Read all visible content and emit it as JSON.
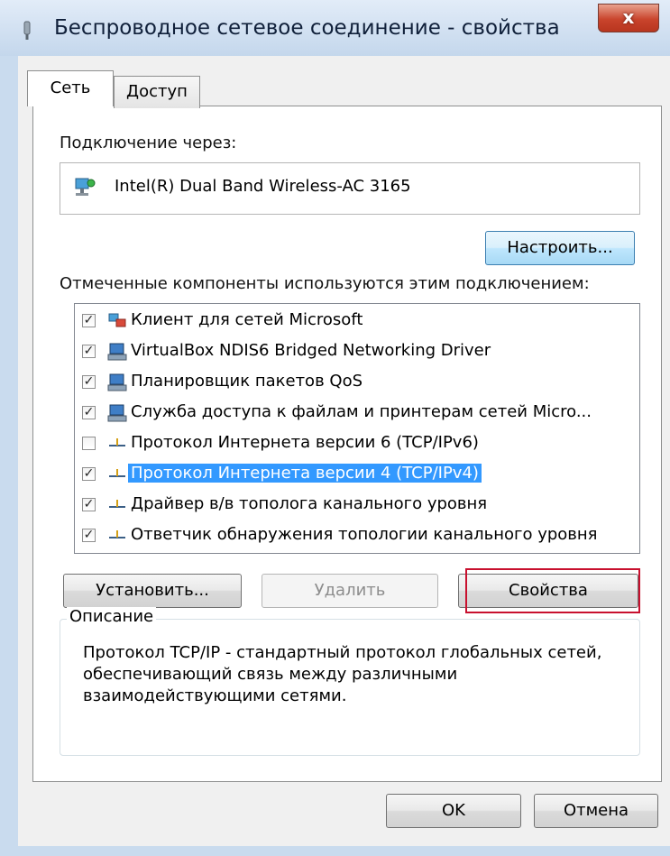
{
  "window": {
    "title": "Беспроводное сетевое соединение - свойства",
    "close_label": "x"
  },
  "tabs": [
    {
      "label": "Сеть",
      "active": true
    },
    {
      "label": "Доступ",
      "active": false
    }
  ],
  "connection": {
    "label": "Подключение через:",
    "adapter_name": "Intel(R) Dual Band Wireless-AC 3165",
    "configure_button": "Настроить..."
  },
  "components": {
    "label": "Отмеченные компоненты используются этим подключением:",
    "items": [
      {
        "label": "Клиент для сетей Microsoft",
        "checked": true,
        "icon": "network-client-icon",
        "selected": false
      },
      {
        "label": "VirtualBox NDIS6 Bridged Networking Driver",
        "checked": true,
        "icon": "network-service-icon",
        "selected": false
      },
      {
        "label": "Планировщик пакетов QoS",
        "checked": true,
        "icon": "network-service-icon",
        "selected": false
      },
      {
        "label": "Служба доступа к файлам и принтерам сетей Micro...",
        "checked": true,
        "icon": "network-service-icon",
        "selected": false
      },
      {
        "label": "Протокол Интернета версии 6 (TCP/IPv6)",
        "checked": false,
        "icon": "protocol-icon",
        "selected": false
      },
      {
        "label": "Протокол Интернета версии 4 (TCP/IPv4)",
        "checked": true,
        "icon": "protocol-icon",
        "selected": true
      },
      {
        "label": "Драйвер в/в тополога канального уровня",
        "checked": true,
        "icon": "protocol-icon",
        "selected": false
      },
      {
        "label": "Ответчик обнаружения топологии канального уровня",
        "checked": true,
        "icon": "protocol-icon",
        "selected": false
      }
    ]
  },
  "actions": {
    "install": "Установить...",
    "remove": "Удалить",
    "properties": "Свойства"
  },
  "description": {
    "title": "Описание",
    "text": "Протокол TCP/IP - стандартный протокол глобальных сетей, обеспечивающий связь между различными взаимодействующими сетями."
  },
  "footer": {
    "ok": "OK",
    "cancel": "Отмена"
  },
  "colors": {
    "selection": "#3399ff",
    "highlight_outline": "#c8102e",
    "focused_button": "#3c7fb1"
  }
}
